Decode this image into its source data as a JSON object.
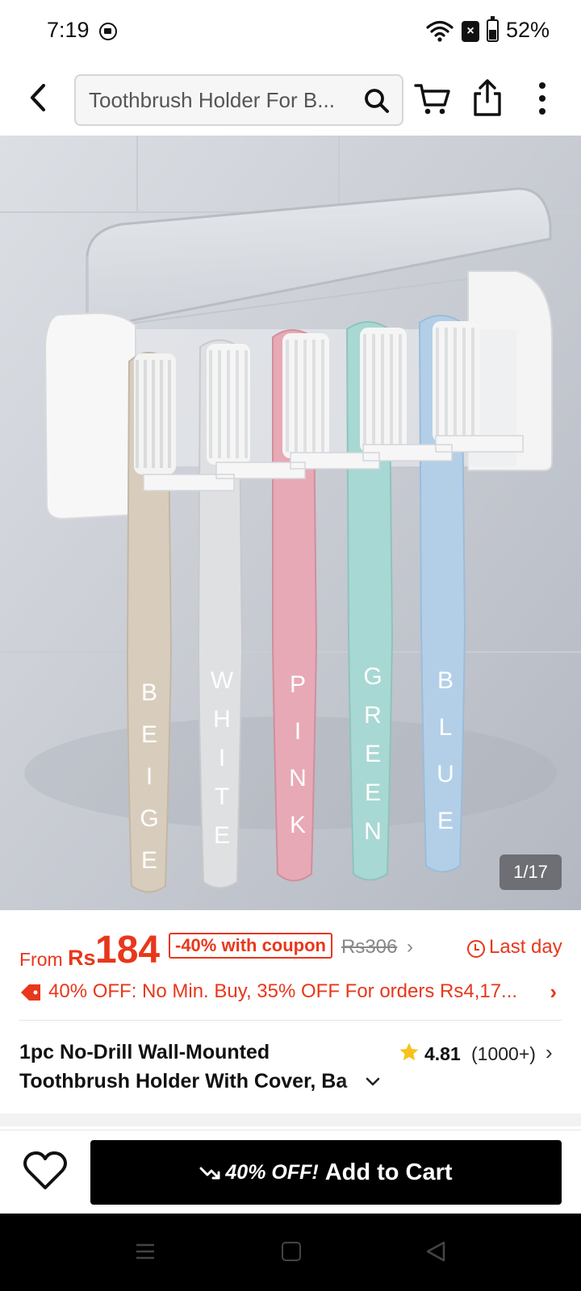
{
  "status_bar": {
    "time": "7:19",
    "battery_percent": "52%",
    "icons": [
      "screen-record-icon",
      "wifi-icon",
      "notification-x-icon",
      "battery-icon"
    ]
  },
  "header": {
    "search_text": "Toothbrush Holder For B...",
    "icons": [
      "back-arrow-icon",
      "search-icon",
      "cart-icon",
      "share-icon",
      "more-vertical-icon"
    ]
  },
  "gallery": {
    "counter": "1/17",
    "brush_labels": [
      "BEIGE",
      "WHITE",
      "PINK",
      "GREEN",
      "BLUE"
    ],
    "brush_colors": [
      "#d8cdbd",
      "#dfe0e2",
      "#e7a9b5",
      "#a8d8d3",
      "#b3cfe8"
    ]
  },
  "price": {
    "from_label": "From",
    "currency": "Rs",
    "value": "184",
    "coupon_badge": "-40% with coupon",
    "original_price": "Rs306",
    "original_chevron": "›",
    "last_day": "Last day",
    "accent_color": "#e8371b"
  },
  "promo": {
    "text": "40% OFF: No Min. Buy,  35% OFF For orders Rs4,17...",
    "chevron": "›"
  },
  "product": {
    "title_line1": "1pc No-Drill Wall-Mounted",
    "title_line2": "Toothbrush Holder With Cover, Ba",
    "rating": "4.81",
    "review_count": "(1000+)",
    "rating_chevron": "›"
  },
  "action_bar": {
    "discount": "40% OFF!",
    "add_to_cart": "Add to Cart"
  }
}
